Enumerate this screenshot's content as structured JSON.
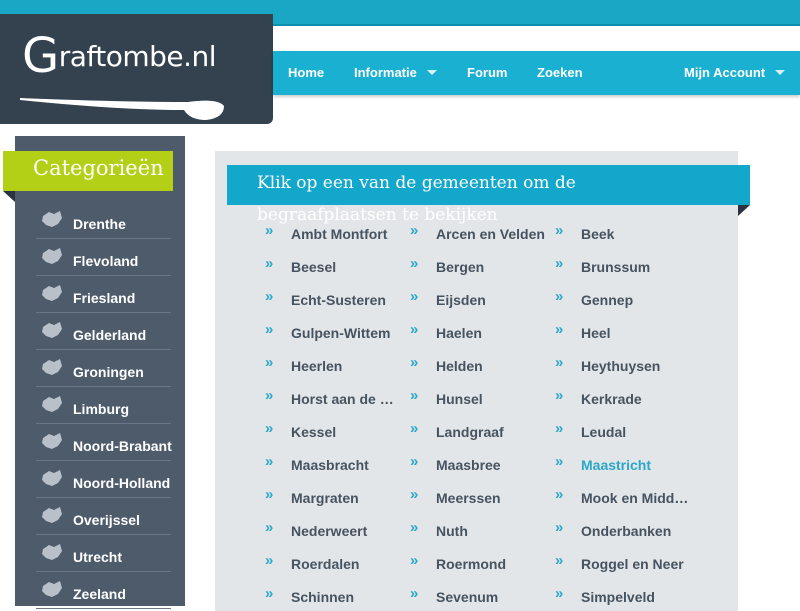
{
  "site": {
    "logo_text": "Graftombe.nl",
    "logo_initial": "G",
    "logo_rest": "raftombe.nl"
  },
  "nav": {
    "items": [
      {
        "label": "Home",
        "dropdown": false
      },
      {
        "label": "Informatie",
        "dropdown": true
      },
      {
        "label": "Forum",
        "dropdown": false
      },
      {
        "label": "Zoeken",
        "dropdown": false
      },
      {
        "label": "Mijn Account",
        "dropdown": true
      }
    ]
  },
  "sidebar": {
    "title": "Categorieën",
    "items": [
      {
        "label": "Drenthe",
        "icon": "drenthe-map-icon"
      },
      {
        "label": "Flevoland",
        "icon": "flevoland-map-icon"
      },
      {
        "label": "Friesland",
        "icon": "friesland-map-icon"
      },
      {
        "label": "Gelderland",
        "icon": "gelderland-map-icon"
      },
      {
        "label": "Groningen",
        "icon": "groningen-map-icon"
      },
      {
        "label": "Limburg",
        "icon": "limburg-map-icon"
      },
      {
        "label": "Noord-Brabant",
        "icon": "noord-brabant-map-icon"
      },
      {
        "label": "Noord-Holland",
        "icon": "noord-holland-map-icon"
      },
      {
        "label": "Overijssel",
        "icon": "overijssel-map-icon"
      },
      {
        "label": "Utrecht",
        "icon": "utrecht-map-icon"
      },
      {
        "label": "Zeeland",
        "icon": "zeeland-map-icon"
      }
    ]
  },
  "main": {
    "header": "Klik op een van de gemeenten om de begraafplaatsen te bekijken",
    "header_line1": "Klik op een van de gemeenten om de",
    "header_line2": "begraafplaatsen te bekijken",
    "chevron": "»",
    "active": "Maastricht",
    "towns": [
      "Ambt Montfort",
      "Arcen en Velden",
      "Beek",
      "Beesel",
      "Bergen",
      "Brunssum",
      "Echt-Susteren",
      "Eijsden",
      "Gennep",
      "Gulpen-Wittem",
      "Haelen",
      "Heel",
      "Heerlen",
      "Helden",
      "Heythuysen",
      "Horst aan de Maas",
      "Hunsel",
      "Kerkrade",
      "Kessel",
      "Landgraaf",
      "Leudal",
      "Maasbracht",
      "Maasbree",
      "Maastricht",
      "Margraten",
      "Meerssen",
      "Mook en Middelaar",
      "Nederweert",
      "Nuth",
      "Onderbanken",
      "Roerdalen",
      "Roermond",
      "Roggel en Neer",
      "Schinnen",
      "Sevenum",
      "Simpelveld"
    ]
  },
  "colors": {
    "accent": "#1ab0d2",
    "sidebar_bg": "#4e5b6b",
    "category_green": "#b3cf16",
    "logo_bg": "#34414f",
    "active_link": "#2aa7c9"
  }
}
